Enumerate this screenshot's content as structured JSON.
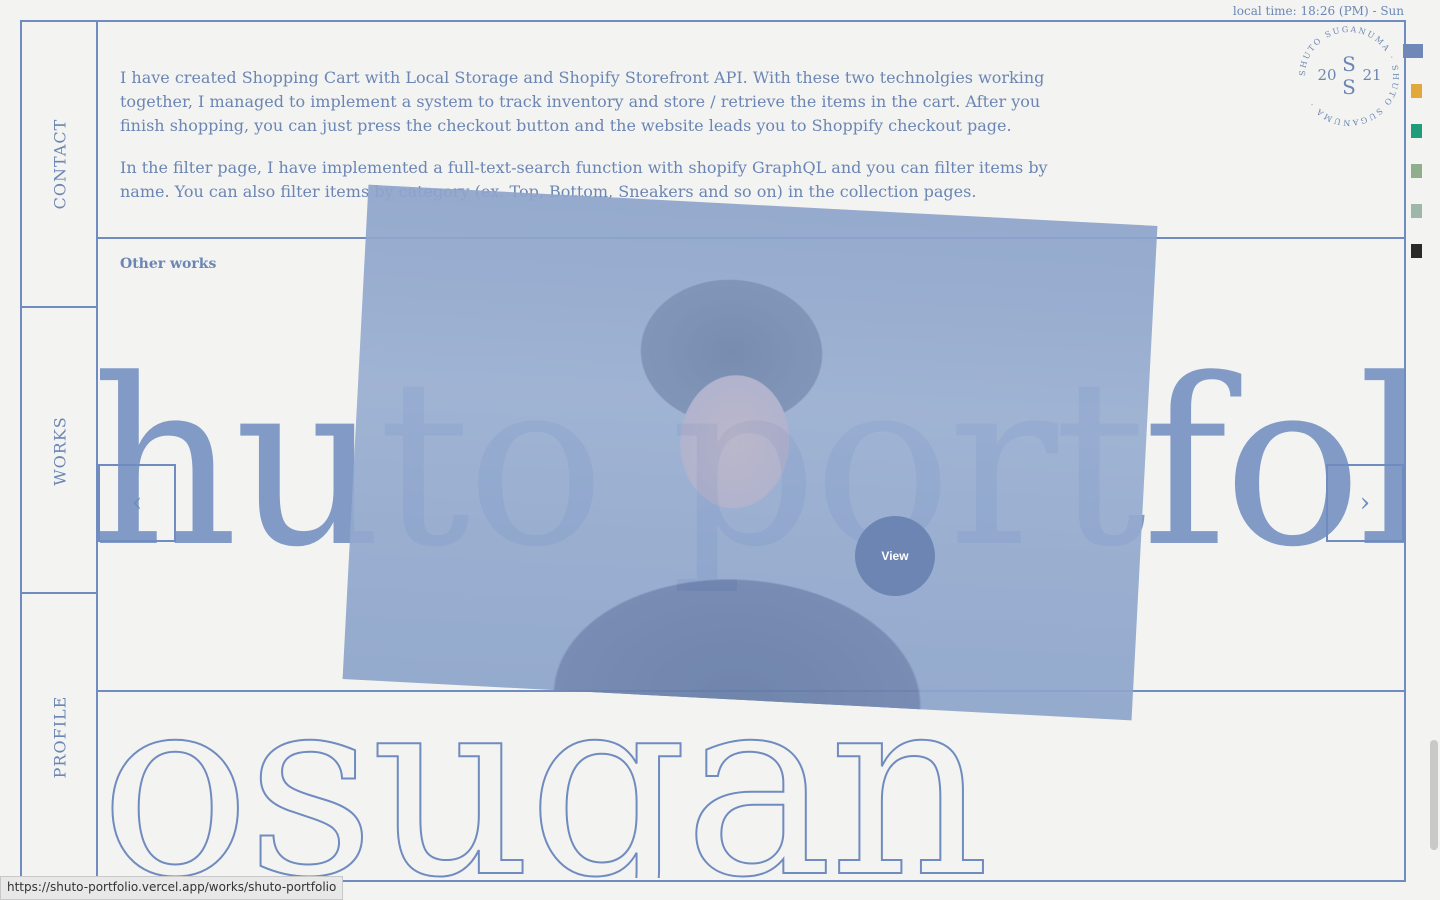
{
  "local_time": "local time: 18:26 (PM) - Sun",
  "sidebar": {
    "items": [
      {
        "label": "CONTACT"
      },
      {
        "label": "WORKS"
      },
      {
        "label": "PROFILE"
      }
    ]
  },
  "description": {
    "paragraph1": "I have created Shopping Cart with Local Storage and Shopify Storefront API. With these two technolgies working together, I managed to implement a system to track inventory and store / retrieve the items in the cart. After you finish shopping, you can just press the checkout button and the website leads you to Shoppify checkout page.",
    "paragraph2": "In the filter page, I have implemented a full-text-search function with shopify GraphQL and you can filter items by name. You can also filter items by category (ex. Top, Bottom, Sneakers and so on) in the collection pages."
  },
  "other_works": {
    "heading": "Other works",
    "big_title": "huto portfoli",
    "view_label": "View",
    "prev_icon": "chevron-left-icon",
    "next_icon": "chevron-right-icon"
  },
  "profile": {
    "outline_title": "osugan"
  },
  "seal": {
    "ring_text": "SHUTO SUGANUMA · SHUTO SUGANUMA ·",
    "left_num": "20",
    "right_num": "21",
    "monogram_top": "S",
    "monogram_bottom": "S"
  },
  "swatches": [
    "#7088b8",
    "#e2a93a",
    "#1f9c7a",
    "#8fae8c",
    "#9fb7a8",
    "#2a2a2a"
  ],
  "status_url": "https://shuto-portfolio.vercel.app/works/shuto-portfolio"
}
